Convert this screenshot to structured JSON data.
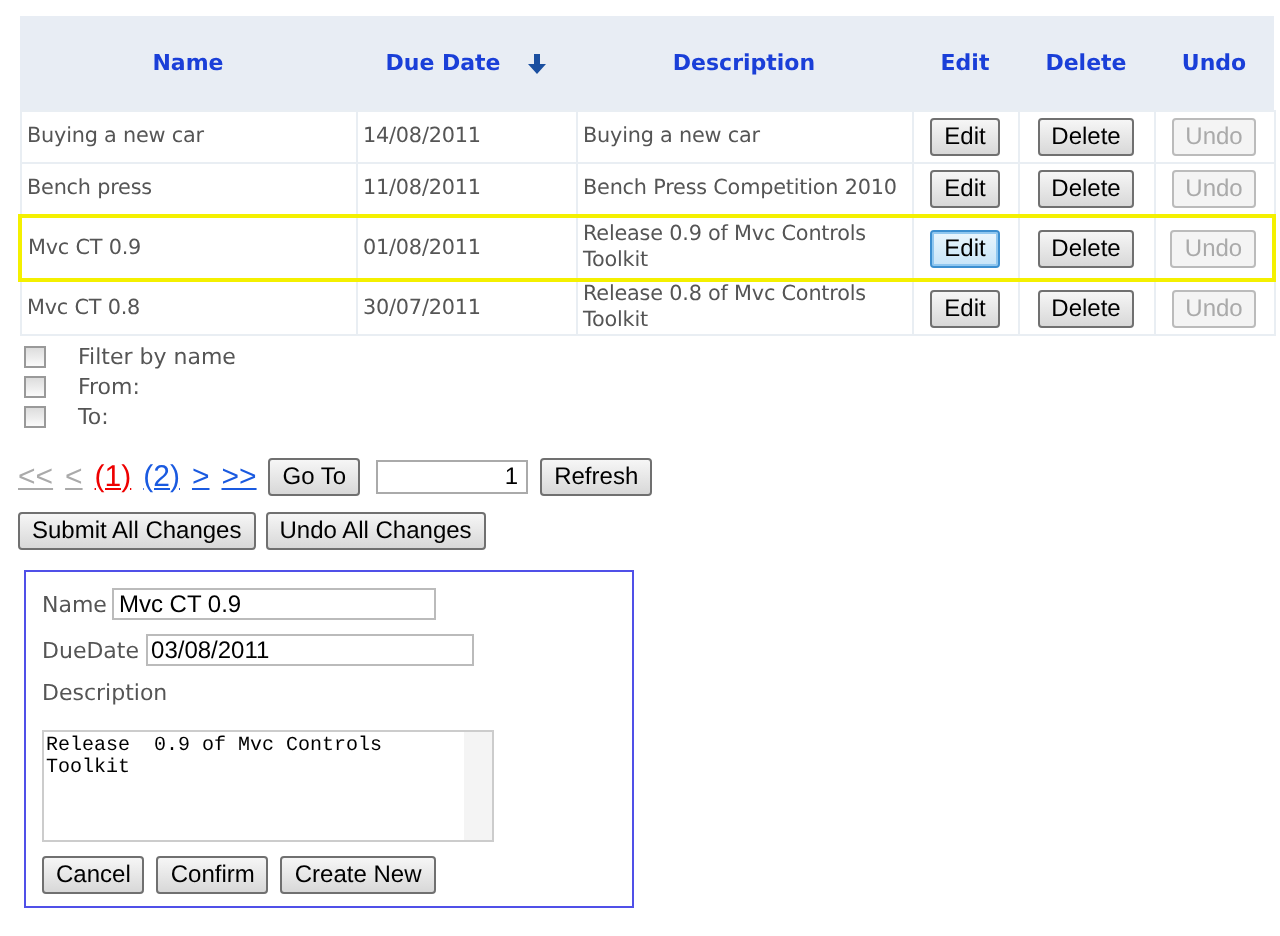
{
  "table": {
    "columns": [
      {
        "label": "Name",
        "sorted": false
      },
      {
        "label": "Due Date",
        "sorted": true
      },
      {
        "label": "Description",
        "sorted": false
      },
      {
        "label": "Edit",
        "sorted": false
      },
      {
        "label": "Delete",
        "sorted": false
      },
      {
        "label": "Undo",
        "sorted": false
      }
    ],
    "rows": [
      {
        "name": "Buying a new car",
        "due_date": "14/08/2011",
        "description": "Buying a new car",
        "edit": "Edit",
        "delete": "Delete",
        "undo": "Undo",
        "undo_disabled": true,
        "selected": false,
        "edit_focused": false
      },
      {
        "name": "Bench press",
        "due_date": "11/08/2011",
        "description": "Bench Press Competition 2010",
        "edit": "Edit",
        "delete": "Delete",
        "undo": "Undo",
        "undo_disabled": true,
        "selected": false,
        "edit_focused": false
      },
      {
        "name": "Mvc CT 0.9",
        "due_date": "01/08/2011",
        "description": "Release  0.9 of Mvc Controls Toolkit",
        "edit": "Edit",
        "delete": "Delete",
        "undo": "Undo",
        "undo_disabled": true,
        "selected": true,
        "edit_focused": true
      },
      {
        "name": "Mvc CT 0.8",
        "due_date": "30/07/2011",
        "description": "Release  0.8 of Mvc Controls Toolkit",
        "edit": "Edit",
        "delete": "Delete",
        "undo": "Undo",
        "undo_disabled": true,
        "selected": false,
        "edit_focused": false
      }
    ]
  },
  "filters": [
    {
      "label": "Filter by name",
      "checked": false
    },
    {
      "label": "From:",
      "checked": false
    },
    {
      "label": "To:",
      "checked": false
    }
  ],
  "pager": {
    "links": [
      {
        "label": "<<",
        "disabled": true,
        "selected": false
      },
      {
        "label": "<",
        "disabled": true,
        "selected": false
      },
      {
        "label": "(1)",
        "disabled": false,
        "selected": true
      },
      {
        "label": "(2)",
        "disabled": false,
        "selected": false
      },
      {
        "label": ">",
        "disabled": false,
        "selected": false
      },
      {
        "label": ">>",
        "disabled": false,
        "selected": false
      }
    ],
    "goto_button": "Go To",
    "page_value": "1",
    "refresh_button": "Refresh"
  },
  "actions": [
    "Submit All Changes",
    "Undo All Changes"
  ],
  "editor": {
    "name_label": "Name",
    "name_value": "Mvc CT 0.9",
    "due_label": "DueDate",
    "due_value": "03/08/2011",
    "description_label": "Description",
    "description_value": "Release  0.9 of Mvc Controls\nToolkit",
    "buttons": [
      "Cancel",
      "Confirm",
      "Create New"
    ]
  }
}
